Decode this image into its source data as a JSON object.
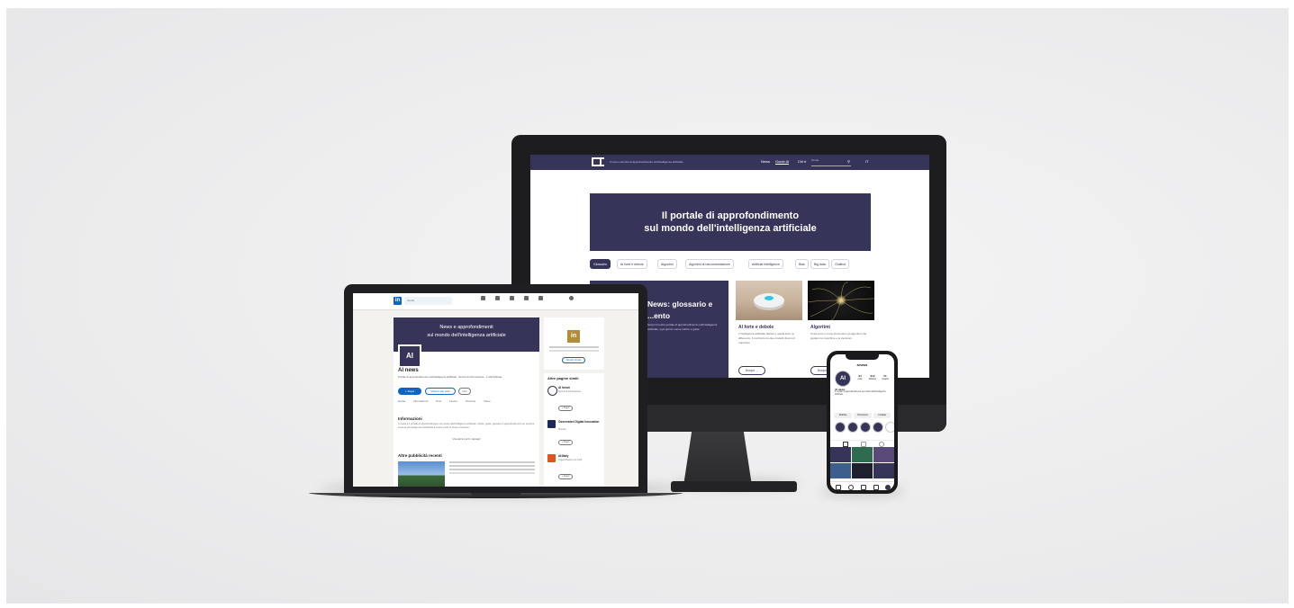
{
  "imac": {
    "nav": {
      "tagline": "Il nuovo servizio di approfondimento sull'intelligenza artificiale",
      "links": [
        "News",
        "Guide AI",
        "Chi è"
      ],
      "search_placeholder": "Cerca",
      "lang": "IT"
    },
    "hero": {
      "line1": "Il portale di approfondimento",
      "line2": "sul mondo dell'intelligenza artificiale"
    },
    "tabs": [
      "Glossario",
      "AI forte e debole",
      "Algoritmi",
      "Algoritmi di raccomandazione",
      "Artificial Intelligence",
      "Bias",
      "Big data",
      "Chatbot"
    ],
    "featured": {
      "title": "News: glossario e ...ento",
      "text": "Scopri il nostro portale di approfondimento sull'intelligenza artificiale, ogni giorno nuove notizie e guide"
    },
    "cards": [
      {
        "title": "AI forte e debole",
        "text": "L'intelligenza artificiale debole e quella forte: le differenze. Il confronto tra due modelli diversi di macchine",
        "button": "Scopri"
      },
      {
        "title": "Algoritmi",
        "text": "Cosa sono e come funzionano gli algoritmi che guidano le macchine e le decisioni",
        "button": "Scopri"
      }
    ]
  },
  "laptop": {
    "topbar": {
      "logo": "in",
      "search": "Cerca"
    },
    "banner": {
      "line1": "News e approfondimenti",
      "line2": "sul mondo dell'intelligenza artificiale"
    },
    "avatar": "AI",
    "page": {
      "name": "AI news",
      "subtitle": "Portale di approfondimento sull'intelligenza artificiale · Servizi di informazione · 1.234 follower",
      "follow": "+ Segui",
      "visit": "Visita il sito web",
      "more": "Altro"
    },
    "tabs": [
      "Home",
      "Informazioni",
      "Post",
      "Lavoro",
      "Persone",
      "Video"
    ],
    "about": {
      "title": "Informazioni",
      "text": "AI news è il portale di approfondimento sul mondo dell'intelligenza artificiale: notizie, guide, glossario e approfondimenti per scoprire come la tecnologia sta cambiando il nostro modo di vivere e lavorare.",
      "link": "Visualizza tutti i dettagli"
    },
    "posts": {
      "title": "Altre pubblicità recenti"
    },
    "side": {
      "badge": "in",
      "button": "Scopri di più",
      "similar_title": "Altre pagine simili",
      "pages": [
        {
          "name": "AI forum",
          "desc": "Servizi di informazione",
          "button": "+ Segui"
        },
        {
          "name": "Osservatori Digital Innovation",
          "desc": "Ricerca",
          "button": "+ Segui"
        },
        {
          "name": "AI4Italy",
          "desc": "Organizzazioni no profit",
          "button": "+ Segui"
        }
      ]
    }
  },
  "phone": {
    "username": "ainews",
    "avatar": "AI",
    "stats": [
      {
        "n": "94",
        "l": "post"
      },
      {
        "n": "612",
        "l": "follower"
      },
      {
        "n": "51",
        "l": "seguiti"
      }
    ],
    "name": "AI news",
    "bio": "Il portale di approfondimento sul mondo dell'intelligenza artificiale",
    "buttons": [
      "Modifica",
      "Promozioni",
      "Contatta"
    ]
  },
  "colors": {
    "brand": "#37345a",
    "linkedin": "#0a66c2",
    "background": "#ececed"
  }
}
